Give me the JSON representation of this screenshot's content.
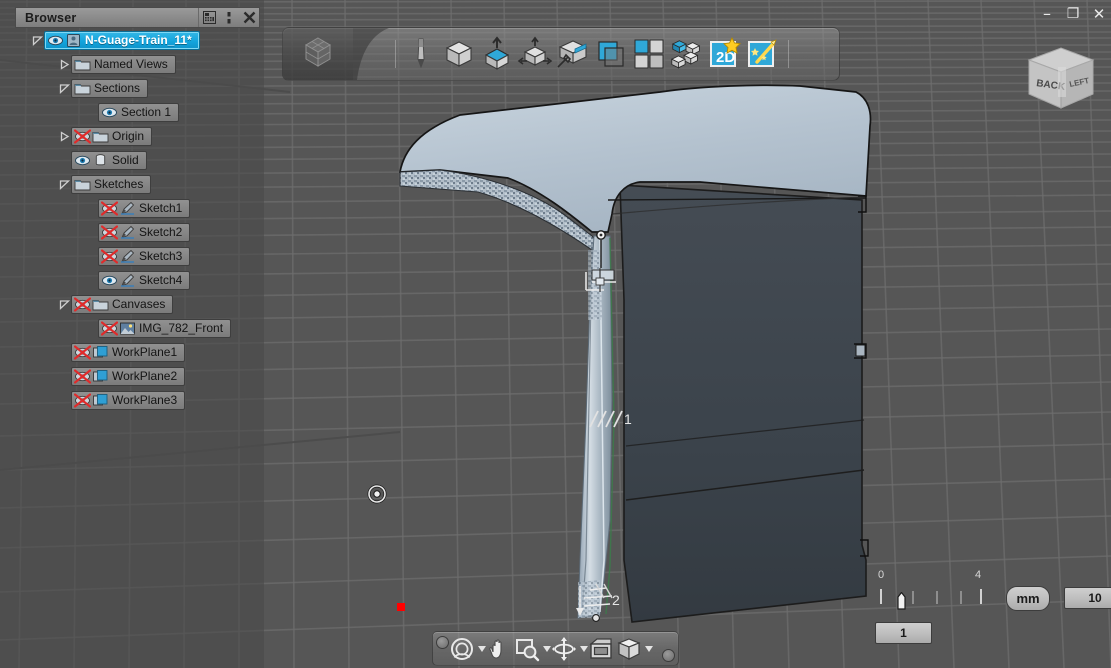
{
  "window": {
    "minimize_label": "–",
    "restore_label": "❐",
    "close_label": "✕"
  },
  "browser": {
    "title": "Browser",
    "header_buttons": [
      {
        "name": "filter-icon",
        "label": ""
      },
      {
        "name": "panel-menu-icon",
        "label": ""
      },
      {
        "name": "close-icon",
        "label": ""
      }
    ],
    "tree": [
      {
        "label": "N-Guage-Train_11*",
        "indent": 0,
        "twisty": "open",
        "icons": [
          "eye",
          "doc"
        ],
        "selected": true
      },
      {
        "label": "Named Views",
        "indent": 1,
        "twisty": "closed",
        "icons": [
          "folder"
        ],
        "selected": false
      },
      {
        "label": "Sections",
        "indent": 1,
        "twisty": "open",
        "icons": [
          "folder"
        ],
        "selected": false
      },
      {
        "label": "Section 1",
        "indent": 2,
        "twisty": "none",
        "icons": [
          "eye"
        ],
        "selected": false
      },
      {
        "label": "Origin",
        "indent": 1,
        "twisty": "closed",
        "icons": [
          "eye-off",
          "folder"
        ],
        "selected": false
      },
      {
        "label": "Solid",
        "indent": 1,
        "twisty": "none",
        "icons": [
          "eye",
          "body"
        ],
        "selected": false
      },
      {
        "label": "Sketches",
        "indent": 1,
        "twisty": "open",
        "icons": [
          "folder"
        ],
        "selected": false
      },
      {
        "label": "Sketch1",
        "indent": 2,
        "twisty": "none",
        "icons": [
          "eye-off",
          "sketch"
        ],
        "selected": false
      },
      {
        "label": "Sketch2",
        "indent": 2,
        "twisty": "none",
        "icons": [
          "eye-off",
          "sketch"
        ],
        "selected": false
      },
      {
        "label": "Sketch3",
        "indent": 2,
        "twisty": "none",
        "icons": [
          "eye-off",
          "sketch"
        ],
        "selected": false
      },
      {
        "label": "Sketch4",
        "indent": 2,
        "twisty": "none",
        "icons": [
          "eye",
          "sketch"
        ],
        "selected": false
      },
      {
        "label": "Canvases",
        "indent": 1,
        "twisty": "open",
        "icons": [
          "eye-off",
          "folder"
        ],
        "selected": false
      },
      {
        "label": "IMG_782_Front",
        "indent": 2,
        "twisty": "none",
        "icons": [
          "eye-off",
          "image"
        ],
        "selected": false
      },
      {
        "label": "WorkPlane1",
        "indent": 1,
        "twisty": "none",
        "icons": [
          "eye-off",
          "plane"
        ],
        "selected": false
      },
      {
        "label": "WorkPlane2",
        "indent": 1,
        "twisty": "none",
        "icons": [
          "eye-off",
          "plane"
        ],
        "selected": false
      },
      {
        "label": "WorkPlane3",
        "indent": 1,
        "twisty": "none",
        "icons": [
          "eye-off",
          "plane"
        ],
        "selected": false
      }
    ]
  },
  "toolbar": {
    "logo_name": "app-logo-icon",
    "items": [
      {
        "name": "sketch-pencil-icon",
        "label": "Sketch"
      },
      {
        "name": "create-box-icon",
        "label": "Create"
      },
      {
        "name": "extrude-icon",
        "label": "Extrude"
      },
      {
        "name": "move-transform-icon",
        "label": "Modify"
      },
      {
        "name": "surface-paint-icon",
        "label": "Appearance"
      },
      {
        "name": "offset-plane-icon",
        "label": "Construct"
      },
      {
        "name": "pattern-grid-icon",
        "label": "Pattern"
      },
      {
        "name": "array-cubes-icon",
        "label": "Array"
      },
      {
        "name": "drawing-2d-icon",
        "label": "2D Drawing"
      },
      {
        "name": "magic-wand-icon",
        "label": "Effects"
      }
    ]
  },
  "viewcube": {
    "face_front_label": "BACK",
    "face_side_label": "LEFT"
  },
  "canvas": {
    "annotations": [
      {
        "label": "1",
        "name": "sketch-constraint-1"
      },
      {
        "label": "2",
        "name": "sketch-constraint-2"
      }
    ]
  },
  "scale": {
    "tick_labels": [
      "0",
      "4"
    ],
    "unit": "mm",
    "max_value": "10",
    "current_value": "1"
  },
  "navbar": {
    "items": [
      {
        "name": "orbit-icon",
        "label": "Orbit",
        "caret": true
      },
      {
        "name": "pan-hand-icon",
        "label": "Pan",
        "caret": false
      },
      {
        "name": "zoom-window-icon",
        "label": "Zoom",
        "caret": true
      },
      {
        "name": "look-at-icon",
        "label": "Look At",
        "caret": true
      },
      {
        "name": "display-settings-icon",
        "label": "Display Settings",
        "caret": false
      },
      {
        "name": "visual-style-icon",
        "label": "Visual Style",
        "caret": true
      }
    ]
  },
  "colors": {
    "background": "#565656",
    "grid_line": "#7a7a7a",
    "accent_selected": "#13a4dd",
    "model_top": "#b9c6d2",
    "model_front": "#3e454c",
    "origin_point": "#ff0000"
  }
}
